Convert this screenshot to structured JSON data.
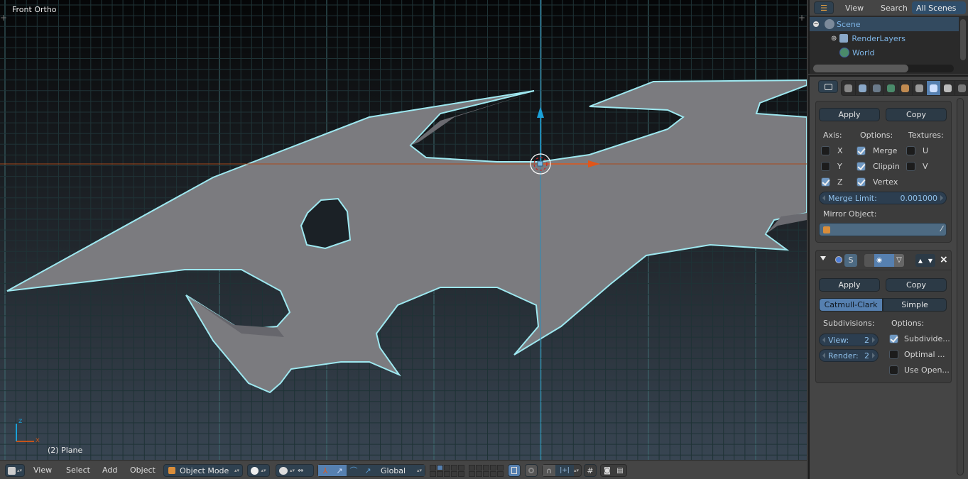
{
  "viewport": {
    "view_name": "Front Ortho",
    "active_object": "(2) Plane",
    "axis_labels": {
      "z": "z",
      "x": "x"
    },
    "colors": {
      "outline": "#9ee8f0",
      "mesh": "#7a7a7e",
      "x_axis": "#c4541a",
      "z_axis": "#1ba1d9"
    }
  },
  "header3d": {
    "menus": [
      "View",
      "Select",
      "Add",
      "Object"
    ],
    "mode": "Object Mode",
    "orientation": "Global",
    "icons": [
      "editor-type-icon",
      "mode-cube-icon",
      "shading-sphere-icon",
      "pivot-icon",
      "manipulator-toggle-icon",
      "translate-icon",
      "rotate-icon",
      "scale-icon",
      "layers-grid",
      "lock-camera-icon",
      "proportional-edit-icon",
      "snap-magnet-icon",
      "snap-target-icon",
      "snap-element-icon",
      "render-icon",
      "render-anim-icon"
    ]
  },
  "outliner": {
    "tabs": [
      "View",
      "Search",
      "All Scenes"
    ],
    "active_tab": "All Scenes",
    "rows": [
      {
        "label": "Scene",
        "icon": "scene-icon",
        "expander": "minus"
      },
      {
        "label": "RenderLayers",
        "icon": "renderlayers-icon",
        "expander": "plus"
      },
      {
        "label": "World",
        "icon": "world-icon",
        "expander": ""
      }
    ]
  },
  "properties": {
    "context_tabs": [
      "render-icon",
      "renderlayers-icon",
      "scene-icon",
      "world-icon",
      "object-icon",
      "constraints-icon",
      "modifiers-wrench-icon",
      "data-mesh-icon",
      "material-icon"
    ],
    "active_context": "modifiers-wrench-icon",
    "mirror": {
      "apply": "Apply",
      "copy": "Copy",
      "axis_label": "Axis:",
      "options_label": "Options:",
      "textures_label": "Textures:",
      "axis": [
        {
          "label": "X",
          "checked": false
        },
        {
          "label": "Y",
          "checked": false
        },
        {
          "label": "Z",
          "checked": true
        }
      ],
      "options": [
        {
          "label": "Merge",
          "checked": true
        },
        {
          "label": "Clippin",
          "checked": true
        },
        {
          "label": "Vertex",
          "checked": true
        }
      ],
      "textures": [
        {
          "label": "U",
          "checked": false
        },
        {
          "label": "V",
          "checked": false
        }
      ],
      "merge_limit_label": "Merge Limit:",
      "merge_limit_value": "0.001000",
      "mirror_object_label": "Mirror Object:",
      "mirror_object_value": ""
    },
    "subsurf": {
      "name_short": "S",
      "apply": "Apply",
      "copy": "Copy",
      "types": [
        "Catmull-Clark",
        "Simple"
      ],
      "active_type": "Catmull-Clark",
      "subdivisions_label": "Subdivisions:",
      "options_label": "Options:",
      "view_label": "View:",
      "view_value": "2",
      "render_label": "Render:",
      "render_value": "2",
      "options": [
        {
          "label": "Subdivide...",
          "checked": true
        },
        {
          "label": "Optimal ...",
          "checked": false
        },
        {
          "label": "Use Open...",
          "checked": false
        }
      ]
    }
  }
}
